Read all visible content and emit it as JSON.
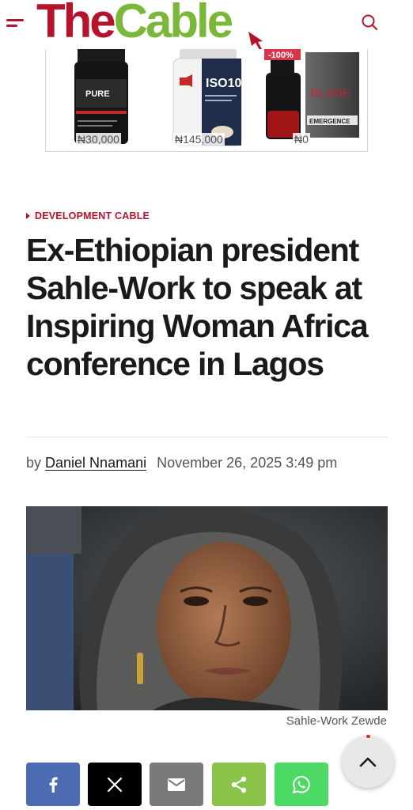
{
  "header": {
    "logo_the": "The",
    "logo_cable": "Cable",
    "menu_icon": "hamburger-menu-icon",
    "search_icon": "search-icon",
    "brand_red": "#b5122b",
    "brand_green": "#7bb83a"
  },
  "ad": {
    "products": [
      {
        "name": "creatine-tub",
        "price": "₦30,000"
      },
      {
        "name": "iso100-tub",
        "price": "₦145,000"
      },
      {
        "name": "blade-perfume",
        "price": "₦0",
        "badge": "-100%"
      }
    ]
  },
  "article": {
    "category": "DEVELOPMENT CABLE",
    "title": "Ex-Ethiopian president Sahle-Work to speak at Inspiring Woman Africa conference in Lagos",
    "by": "by",
    "author": "Daniel Nnamani",
    "date": "November 26, 2025 3:49 pm",
    "image_caption": "Sahle-Work Zewde"
  },
  "share": {
    "buttons": [
      {
        "name": "facebook",
        "icon": "facebook-icon",
        "color": "#4c6bb3"
      },
      {
        "name": "x",
        "icon": "x-icon",
        "color": "#000000"
      },
      {
        "name": "email",
        "icon": "email-icon",
        "color": "#7a7a7a"
      },
      {
        "name": "share",
        "icon": "share-icon",
        "color": "#8bc34a"
      },
      {
        "name": "whatsapp",
        "icon": "whatsapp-icon",
        "color": "#4cd964"
      }
    ]
  },
  "back_to_top_icon": "chevron-up-icon"
}
